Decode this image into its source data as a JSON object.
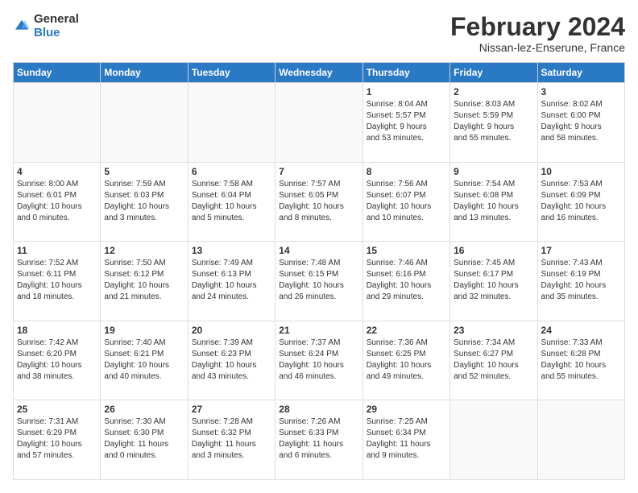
{
  "logo": {
    "general": "General",
    "blue": "Blue"
  },
  "header": {
    "month": "February 2024",
    "location": "Nissan-lez-Enserune, France"
  },
  "weekdays": [
    "Sunday",
    "Monday",
    "Tuesday",
    "Wednesday",
    "Thursday",
    "Friday",
    "Saturday"
  ],
  "weeks": [
    [
      {
        "day": "",
        "info": ""
      },
      {
        "day": "",
        "info": ""
      },
      {
        "day": "",
        "info": ""
      },
      {
        "day": "",
        "info": ""
      },
      {
        "day": "1",
        "info": "Sunrise: 8:04 AM\nSunset: 5:57 PM\nDaylight: 9 hours\nand 53 minutes."
      },
      {
        "day": "2",
        "info": "Sunrise: 8:03 AM\nSunset: 5:59 PM\nDaylight: 9 hours\nand 55 minutes."
      },
      {
        "day": "3",
        "info": "Sunrise: 8:02 AM\nSunset: 6:00 PM\nDaylight: 9 hours\nand 58 minutes."
      }
    ],
    [
      {
        "day": "4",
        "info": "Sunrise: 8:00 AM\nSunset: 6:01 PM\nDaylight: 10 hours\nand 0 minutes."
      },
      {
        "day": "5",
        "info": "Sunrise: 7:59 AM\nSunset: 6:03 PM\nDaylight: 10 hours\nand 3 minutes."
      },
      {
        "day": "6",
        "info": "Sunrise: 7:58 AM\nSunset: 6:04 PM\nDaylight: 10 hours\nand 5 minutes."
      },
      {
        "day": "7",
        "info": "Sunrise: 7:57 AM\nSunset: 6:05 PM\nDaylight: 10 hours\nand 8 minutes."
      },
      {
        "day": "8",
        "info": "Sunrise: 7:56 AM\nSunset: 6:07 PM\nDaylight: 10 hours\nand 10 minutes."
      },
      {
        "day": "9",
        "info": "Sunrise: 7:54 AM\nSunset: 6:08 PM\nDaylight: 10 hours\nand 13 minutes."
      },
      {
        "day": "10",
        "info": "Sunrise: 7:53 AM\nSunset: 6:09 PM\nDaylight: 10 hours\nand 16 minutes."
      }
    ],
    [
      {
        "day": "11",
        "info": "Sunrise: 7:52 AM\nSunset: 6:11 PM\nDaylight: 10 hours\nand 18 minutes."
      },
      {
        "day": "12",
        "info": "Sunrise: 7:50 AM\nSunset: 6:12 PM\nDaylight: 10 hours\nand 21 minutes."
      },
      {
        "day": "13",
        "info": "Sunrise: 7:49 AM\nSunset: 6:13 PM\nDaylight: 10 hours\nand 24 minutes."
      },
      {
        "day": "14",
        "info": "Sunrise: 7:48 AM\nSunset: 6:15 PM\nDaylight: 10 hours\nand 26 minutes."
      },
      {
        "day": "15",
        "info": "Sunrise: 7:46 AM\nSunset: 6:16 PM\nDaylight: 10 hours\nand 29 minutes."
      },
      {
        "day": "16",
        "info": "Sunrise: 7:45 AM\nSunset: 6:17 PM\nDaylight: 10 hours\nand 32 minutes."
      },
      {
        "day": "17",
        "info": "Sunrise: 7:43 AM\nSunset: 6:19 PM\nDaylight: 10 hours\nand 35 minutes."
      }
    ],
    [
      {
        "day": "18",
        "info": "Sunrise: 7:42 AM\nSunset: 6:20 PM\nDaylight: 10 hours\nand 38 minutes."
      },
      {
        "day": "19",
        "info": "Sunrise: 7:40 AM\nSunset: 6:21 PM\nDaylight: 10 hours\nand 40 minutes."
      },
      {
        "day": "20",
        "info": "Sunrise: 7:39 AM\nSunset: 6:23 PM\nDaylight: 10 hours\nand 43 minutes."
      },
      {
        "day": "21",
        "info": "Sunrise: 7:37 AM\nSunset: 6:24 PM\nDaylight: 10 hours\nand 46 minutes."
      },
      {
        "day": "22",
        "info": "Sunrise: 7:36 AM\nSunset: 6:25 PM\nDaylight: 10 hours\nand 49 minutes."
      },
      {
        "day": "23",
        "info": "Sunrise: 7:34 AM\nSunset: 6:27 PM\nDaylight: 10 hours\nand 52 minutes."
      },
      {
        "day": "24",
        "info": "Sunrise: 7:33 AM\nSunset: 6:28 PM\nDaylight: 10 hours\nand 55 minutes."
      }
    ],
    [
      {
        "day": "25",
        "info": "Sunrise: 7:31 AM\nSunset: 6:29 PM\nDaylight: 10 hours\nand 57 minutes."
      },
      {
        "day": "26",
        "info": "Sunrise: 7:30 AM\nSunset: 6:30 PM\nDaylight: 11 hours\nand 0 minutes."
      },
      {
        "day": "27",
        "info": "Sunrise: 7:28 AM\nSunset: 6:32 PM\nDaylight: 11 hours\nand 3 minutes."
      },
      {
        "day": "28",
        "info": "Sunrise: 7:26 AM\nSunset: 6:33 PM\nDaylight: 11 hours\nand 6 minutes."
      },
      {
        "day": "29",
        "info": "Sunrise: 7:25 AM\nSunset: 6:34 PM\nDaylight: 11 hours\nand 9 minutes."
      },
      {
        "day": "",
        "info": ""
      },
      {
        "day": "",
        "info": ""
      }
    ]
  ]
}
